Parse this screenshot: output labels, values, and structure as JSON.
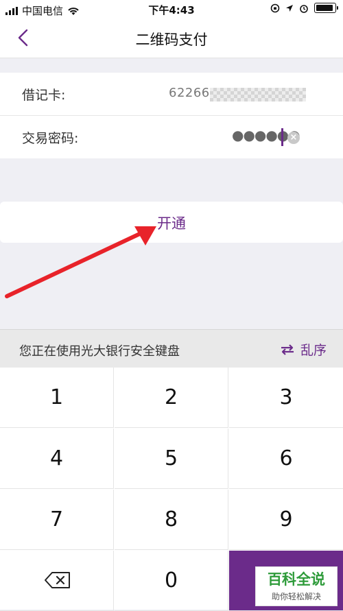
{
  "status_bar": {
    "carrier": "中国电信",
    "time": "下午4:43"
  },
  "nav": {
    "title": "二维码支付"
  },
  "form": {
    "card_label": "借记卡:",
    "card_number_visible": "62266",
    "password_label": "交易密码:",
    "password_masked": "●●●●●●"
  },
  "actions": {
    "open_label": "开通"
  },
  "keyboard": {
    "title": "您正在使用光大银行安全键盘",
    "shuffle_label": "乱序",
    "keys": [
      "1",
      "2",
      "3",
      "4",
      "5",
      "6",
      "7",
      "8",
      "9",
      "0"
    ]
  },
  "watermark": {
    "title": "百科全说",
    "subtitle": "助你轻松解决"
  },
  "colors": {
    "accent": "#6b2b8a",
    "annotation_arrow": "#e8232a",
    "watermark_green": "#2e9b3a"
  }
}
